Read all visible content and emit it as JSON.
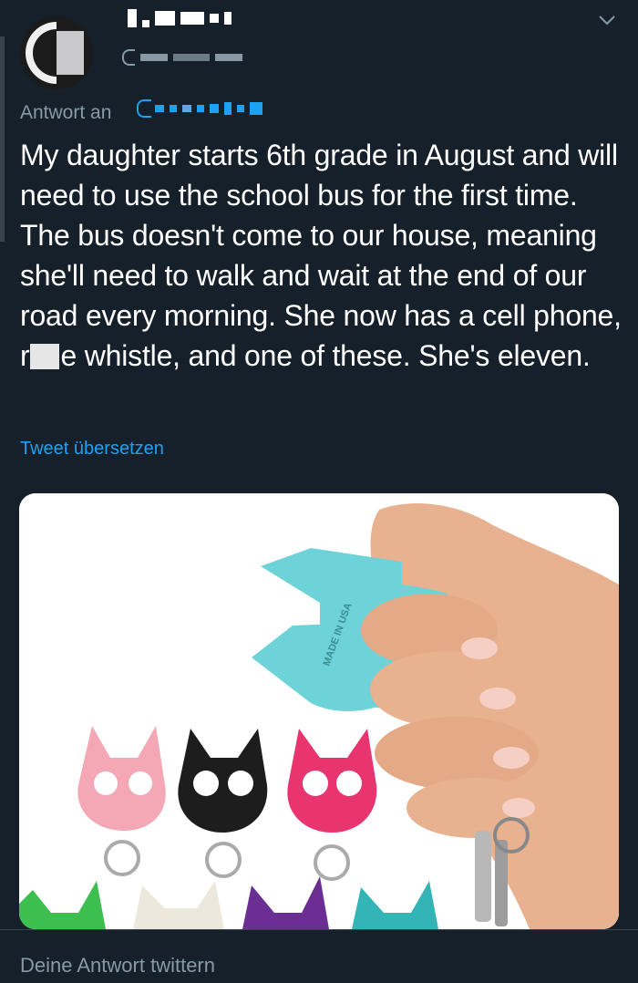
{
  "tweet": {
    "reply_prefix": "Antwort an",
    "text_part1": "My daughter starts 6th grade in August and will need to use the school bus for the first time. The bus doesn't come to our house, meaning she'll need to walk and wait at the end of our road every morning. She now has a cell phone, r",
    "text_part2": "e whistle, and one of these. She's eleven.",
    "translate_label": "Tweet übersetzen"
  },
  "media": {
    "key_label": "MADE IN USA",
    "colors": {
      "teal": "#6ed3d8",
      "pink": "#f4a7b5",
      "black": "#1d1d1d",
      "magenta": "#e8346f",
      "green": "#3cbf4e",
      "ivory": "#ece8dc",
      "purple": "#6b2f94",
      "teal2": "#33b5b5",
      "skin": "#e8b18f"
    }
  },
  "composer": {
    "placeholder": "Deine Antwort twittern"
  },
  "icons": {
    "chevron": "chevron-down-icon"
  }
}
